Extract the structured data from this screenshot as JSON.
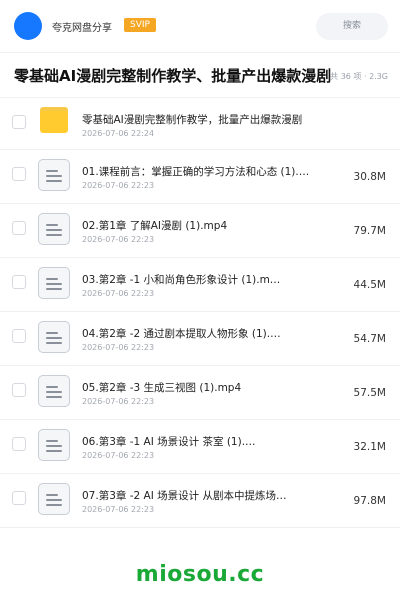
{
  "header": {
    "brand": "夸克网盘分享",
    "badge": "SVIP",
    "search_label": "搜索"
  },
  "title_bar": {
    "title": "零基础AI漫剧完整制作教学、批量产出爆款漫剧",
    "meta": "共 36 项 · 2.3G"
  },
  "colors": {
    "brand_blue": "#1677ff",
    "badge_orange": "#f5a623",
    "folder_yellow": "#ffcb2f",
    "watermark_green": "#1aa836"
  },
  "files": [
    {
      "type": "folder",
      "icon": "folder-icon",
      "name": "零基础AI漫剧完整制作教学，批量产出爆款漫剧",
      "date": "2026-07-06 22:24",
      "size": ""
    },
    {
      "type": "file",
      "icon": "document-icon",
      "name": "01.课程前言：掌握正确的学习方法和心态 (1).…",
      "date": "2026-07-06 22:23",
      "size": "30.8M"
    },
    {
      "type": "file",
      "icon": "document-icon",
      "name": "02.第1章 了解AI漫剧 (1).mp4",
      "date": "2026-07-06 22:23",
      "size": "79.7M"
    },
    {
      "type": "file",
      "icon": "document-icon",
      "name": "03.第2章 -1 小和尚角色形象设计 (1).m…",
      "date": "2026-07-06 22:23",
      "size": "44.5M"
    },
    {
      "type": "file",
      "icon": "document-icon",
      "name": "04.第2章 -2 通过剧本提取人物形象 (1).…",
      "date": "2026-07-06 22:23",
      "size": "54.7M"
    },
    {
      "type": "file",
      "icon": "document-icon",
      "name": "05.第2章 -3 生成三视图 (1).mp4",
      "date": "2026-07-06 22:23",
      "size": "57.5M"
    },
    {
      "type": "file",
      "icon": "document-icon",
      "name": "06.第3章 -1 AI 场景设计 茶室 (1).…",
      "date": "2026-07-06 22:23",
      "size": "32.1M"
    },
    {
      "type": "file",
      "icon": "document-icon",
      "name": "07.第3章 -2 AI 场景设计 从剧本中提炼场…",
      "date": "2026-07-06 22:23",
      "size": "97.8M"
    }
  ],
  "watermark": "miosou.cc"
}
